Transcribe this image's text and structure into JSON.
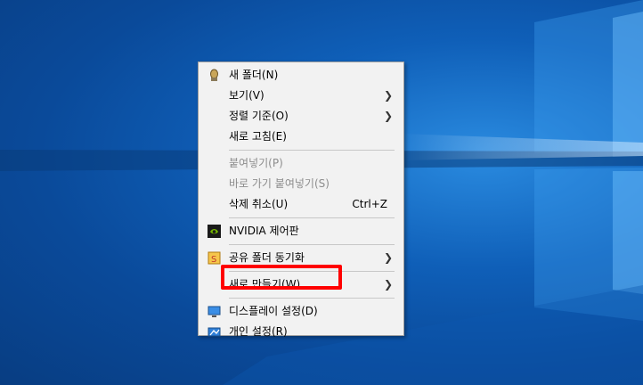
{
  "colors": {
    "accent_highlight": "#ff0000",
    "menu_bg": "#f2f2f2",
    "disabled_text": "#8d8d8d"
  },
  "menu": {
    "new_folder": {
      "label": "새 폴더(N)",
      "icon": "folder-user-icon"
    },
    "view": {
      "label": "보기(V)"
    },
    "sort_by": {
      "label": "정렬 기준(O)"
    },
    "refresh": {
      "label": "새로 고침(E)"
    },
    "paste": {
      "label": "붙여넣기(P)"
    },
    "paste_shortcut": {
      "label": "바로 가기 붙여넣기(S)"
    },
    "undo_delete": {
      "label": "삭제 취소(U)",
      "shortcut": "Ctrl+Z"
    },
    "nvidia": {
      "label": "NVIDIA 제어판",
      "icon": "nvidia-icon"
    },
    "shared_sync": {
      "label": "공유 폴더 동기화",
      "icon": "sync-icon"
    },
    "new": {
      "label": "새로 만들기(W)"
    },
    "display": {
      "label": "디스플레이 설정(D)",
      "icon": "display-icon"
    },
    "personalize": {
      "label": "개인 설정(R)",
      "icon": "personalize-icon"
    }
  }
}
